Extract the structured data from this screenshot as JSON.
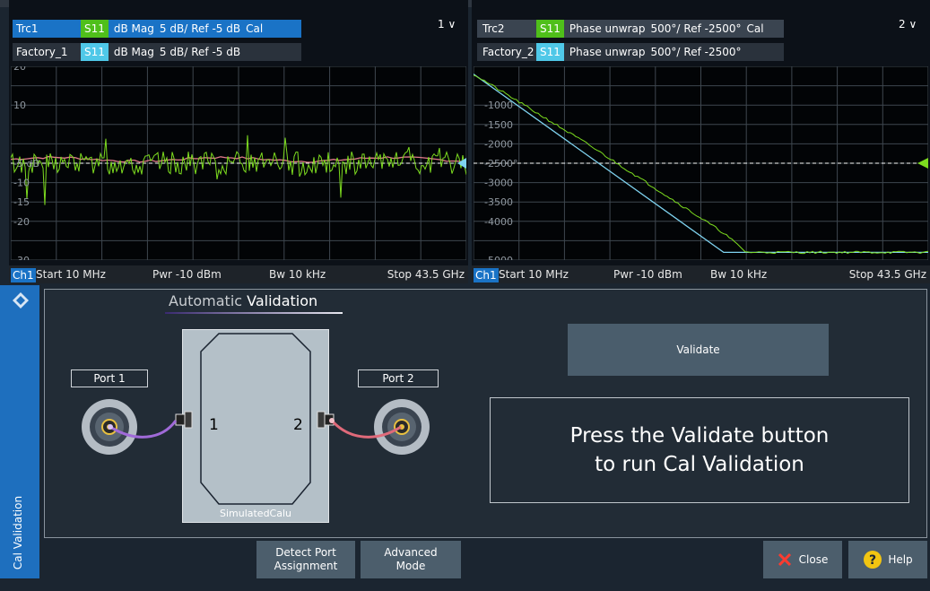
{
  "left_panel": {
    "trace1": {
      "name": "Trc1",
      "param": "S11",
      "format": "dB Mag",
      "scale": "5 dB/",
      "ref": "Ref -5 dB",
      "cal": "Cal"
    },
    "trace2": {
      "name": "Factory_1",
      "param": "S11",
      "format": "dB Mag",
      "scale": "5 dB/",
      "ref": "Ref -5 dB"
    },
    "selector": "1 ∨",
    "y_tick_labels": [
      "20",
      "10",
      "-5 dB",
      "-10",
      "-15",
      "-20",
      "-30"
    ],
    "channel": {
      "label": "Ch1",
      "start": "Start 10 MHz",
      "power": "Pwr -10 dBm",
      "bw": "Bw 10 kHz",
      "stop": "Stop 43.5 GHz"
    }
  },
  "right_panel": {
    "trace1": {
      "name": "Trc2",
      "param": "S11",
      "format": "Phase unwrap",
      "scale": "500°/",
      "ref": "Ref -2500°",
      "cal": "Cal"
    },
    "trace2": {
      "name": "Factory_2",
      "param": "S11",
      "format": "Phase unwrap",
      "scale": "500°/",
      "ref": "Ref -2500°"
    },
    "selector": "2 ∨",
    "y_tick_labels": [
      "-1000",
      "-1500",
      "-2000",
      "-2500°",
      "-3000",
      "-3500",
      "-4000",
      "-5000"
    ],
    "channel": {
      "label": "Ch1",
      "start": "Start 10 MHz",
      "power": "Pwr -10 dBm",
      "bw": "Bw 10 kHz",
      "stop": "Stop 43.5 GHz"
    }
  },
  "sidebar": {
    "label": "Cal Validation"
  },
  "dialog": {
    "title_prefix": "Automatic",
    "title_bold": "Validation",
    "port1": "Port 1",
    "port2": "Port 2",
    "dut_port1": "1",
    "dut_port2": "2",
    "dut_name": "SimulatedCalu",
    "validate_button": "Validate",
    "message_line1": "Press the Validate button",
    "message_line2": "to run Cal Validation"
  },
  "bottom_buttons": {
    "detect": [
      "Detect Port",
      "Assignment"
    ],
    "advanced": [
      "Advanced",
      "Mode"
    ],
    "close": "Close",
    "help": "Help"
  },
  "colors": {
    "trace_measured": "#7ddc1f",
    "trace_reference_left": "#e07a8a",
    "trace_reference_right": "#7fd3f0",
    "s11_measured_bg": "#4fbf1a",
    "s11_factory_bg": "#4fc8e8",
    "accent": "#1a73c6",
    "cable1": "#a06ad8",
    "cable2": "#e06a7a"
  },
  "chart_data": [
    {
      "type": "line",
      "title": "Trc1 S11 dB Mag",
      "ylabel": "dB",
      "ylim": [
        -30,
        20
      ],
      "yticks": [
        20,
        10,
        -5,
        -10,
        -15,
        -20,
        -30
      ],
      "reference_level": -5,
      "xrange": [
        "10 MHz",
        "43.5 GHz"
      ],
      "series": [
        {
          "name": "Trc1",
          "approx_level": -5
        },
        {
          "name": "Factory_1",
          "approx_level": -4
        }
      ]
    },
    {
      "type": "line",
      "title": "Trc2 S11 Phase unwrap",
      "ylabel": "°",
      "ylim": [
        -5000,
        0
      ],
      "yticks": [
        -1000,
        -1500,
        -2000,
        -2500,
        -3000,
        -3500,
        -4000,
        -5000
      ],
      "reference_level": -2500,
      "xrange": [
        "10 MHz",
        "43.5 GHz"
      ],
      "series": [
        {
          "name": "Trc2",
          "points": [
            [
              0,
              -200
            ],
            [
              0.25,
              -2000
            ],
            [
              0.55,
              -4300
            ],
            [
              0.6,
              -4800
            ],
            [
              1.0,
              -4800
            ]
          ]
        },
        {
          "name": "Factory_2",
          "points": [
            [
              0,
              -200
            ],
            [
              0.55,
              -4800
            ],
            [
              1.0,
              -4800
            ]
          ]
        }
      ]
    }
  ]
}
